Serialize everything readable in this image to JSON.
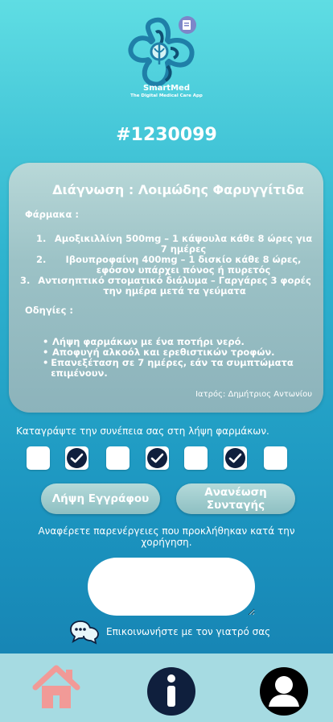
{
  "app": {
    "name": "SmartMed",
    "tagline": "The Digital Medical Care App"
  },
  "prescription": {
    "id": "#1230099",
    "diagnosis": "Διάγνωση : Λοιμώδης Φαρυγγίτιδα",
    "meds_label": "Φάρμακα :",
    "meds": [
      {
        "num": "1.",
        "text": "Αμοξικιλλίνη 500mg – 1 κάψουλα κάθε 8 ώρες για 7 ημέρες"
      },
      {
        "num": "2.",
        "text": "Ιβουπροφαίνη 400mg – 1 δισκίο κάθε 8 ώρες, εφόσον υπάρχει πόνος ή πυρετός"
      },
      {
        "num": "3.",
        "text": "Αντισηπτικό στοματικό διάλυμα – Γαργάρες 3 φορές την ημέρα μετά τα γεύματα"
      }
    ],
    "instructions_label": "Οδηγίες :",
    "instructions": [
      "Λήψη φαρμάκων με ένα ποτήρι νερό.",
      "Αποφυγή αλκοόλ και ερεθιστικών τροφών.",
      "Επανεξέταση σε 7 ημέρες, εάν τα συμπτώματα επιμένουν."
    ],
    "doctor": "Ιατρός: Δημήτριος Αντωνίου"
  },
  "adherence": {
    "label": "Καταγράψτε την συνέπεια σας στη λήψη φαρμάκων.",
    "days": [
      false,
      true,
      false,
      true,
      false,
      true,
      false
    ]
  },
  "actions": {
    "download_label": "Λήψη Εγγράφου",
    "renew_label": "Ανανέωση Συνταγής"
  },
  "side_effects": {
    "label": "Αναφέρετε παρενέργειες που προκλήθηκαν κατά την χορήγηση.",
    "value": ""
  },
  "contact": {
    "label": "Επικοινωνήστε με τον γιατρό σας"
  },
  "nav": {
    "icons": [
      "home-icon",
      "info-icon",
      "profile-icon"
    ]
  },
  "colors": {
    "accent": "#1c95c0",
    "card": "#9cc2c6",
    "check_fill": "#0f1f3d",
    "navbar": "#a6dbe2"
  }
}
